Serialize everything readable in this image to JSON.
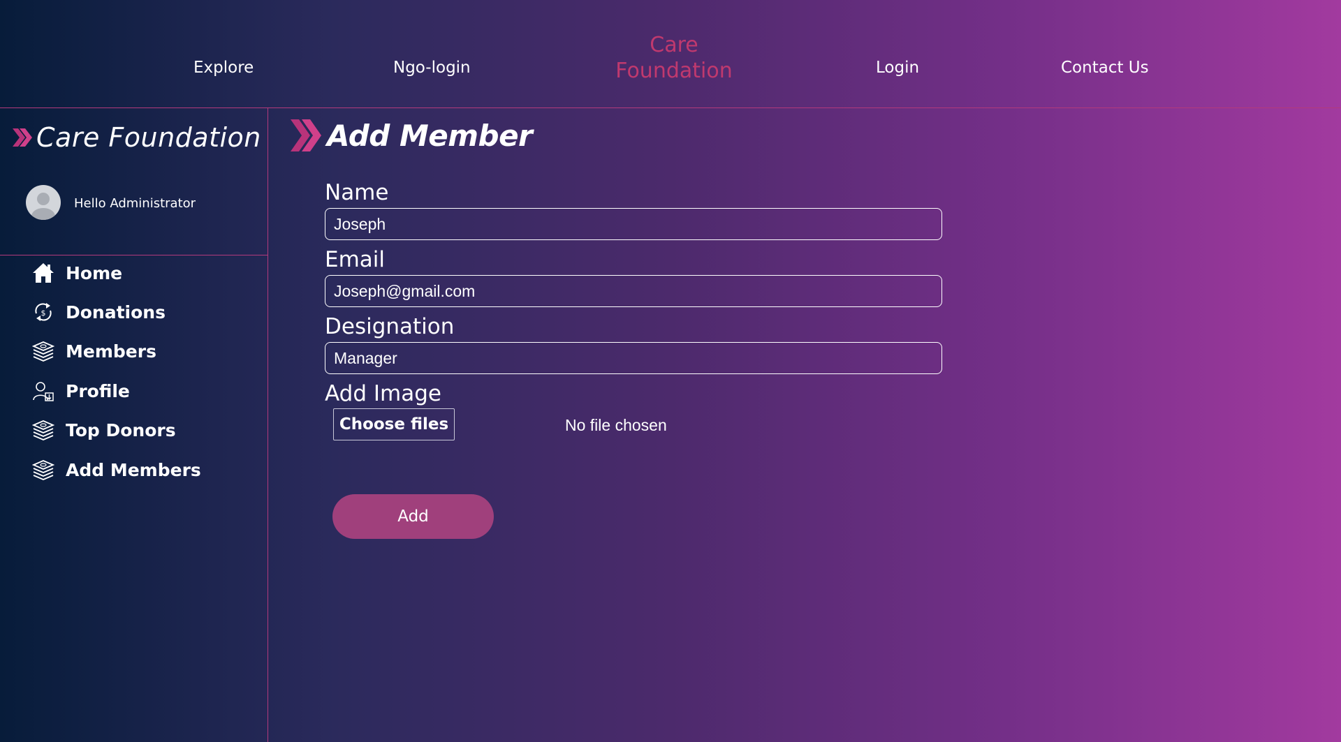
{
  "nav": {
    "explore": "Explore",
    "ngo_login": "Ngo-login",
    "brand_line1": "Care",
    "brand_line2": "Foundation",
    "login": "Login",
    "contact": "Contact Us"
  },
  "sidebar": {
    "brand": "Care Foundation",
    "greeting": "Hello Administrator",
    "items": [
      {
        "label": "Home",
        "icon": "home-icon"
      },
      {
        "label": "Donations",
        "icon": "donation-cycle-icon"
      },
      {
        "label": "Members",
        "icon": "money-stack-icon"
      },
      {
        "label": "Profile",
        "icon": "user-profile-icon"
      },
      {
        "label": "Top Donors",
        "icon": "money-stack-icon"
      },
      {
        "label": "Add Members",
        "icon": "money-stack-icon"
      }
    ]
  },
  "form": {
    "title": "Add Member",
    "name_label": "Name",
    "name_value": "Joseph",
    "email_label": "Email",
    "email_value": "Joseph@gmail.com",
    "designation_label": "Designation",
    "designation_value": "Manager",
    "image_label": "Add Image",
    "choose_files": "Choose files",
    "no_file": "No file chosen",
    "submit": "Add"
  },
  "colors": {
    "accent": "#c0396e",
    "button": "#a0407c",
    "divider": "#b33a7c"
  }
}
